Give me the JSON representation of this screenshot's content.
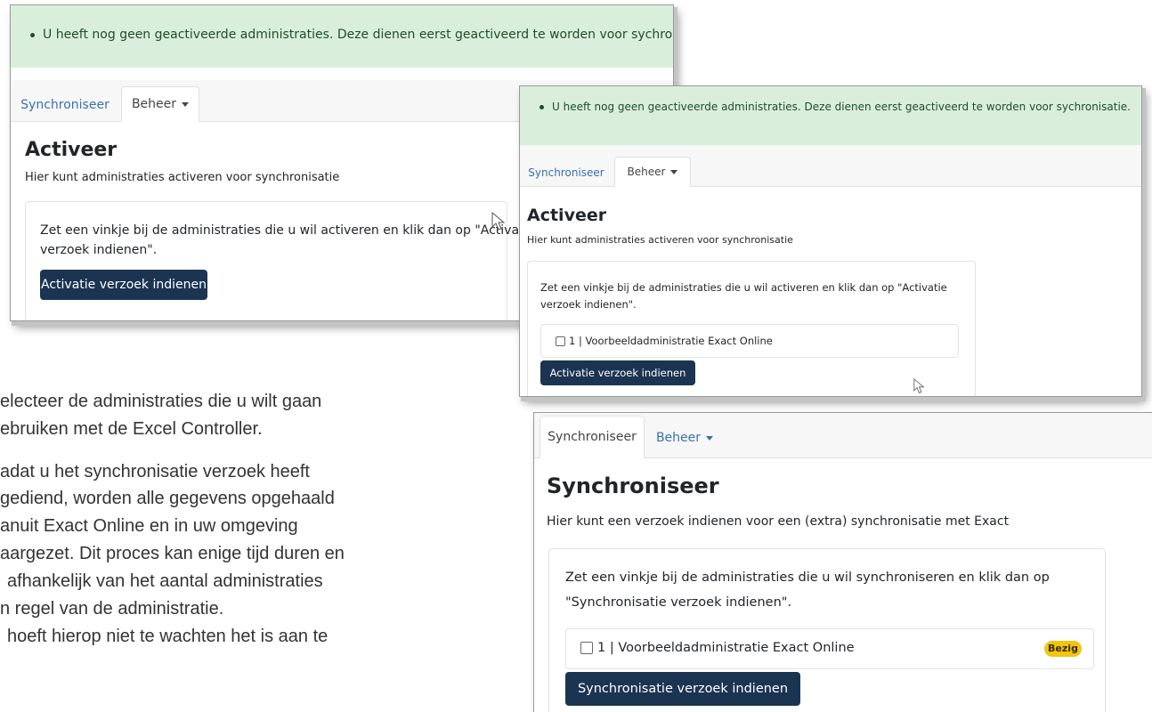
{
  "alert_text": "U heeft nog geen geactiveerde administraties. Deze dienen eerst geactiveerd te worden voor sychronisatie.",
  "tabs": {
    "sync": "Synchroniseer",
    "manage": "Beheer"
  },
  "activate": {
    "title": "Activeer",
    "subtitle": "Hier kunt administraties activeren voor synchronisatie",
    "instruction_line1": "Zet een vinkje bij de administraties die u wil activeren en klik dan op \"Activatie",
    "instruction_line2": "verzoek indienen\".",
    "button": "Activatie verzoek indienen",
    "admin_item": "1 | Voorbeeldadministratie Exact Online"
  },
  "sync": {
    "title": "Synchroniseer",
    "subtitle": "Hier kunt een verzoek indienen voor een (extra) synchronisatie met Exact",
    "instruction_line1": "Zet een vinkje bij de administraties die u wil synchroniseren en klik dan op",
    "instruction_line2": "\"Synchronisatie verzoek indienen\".",
    "admin_item": "1 | Voorbeeldadministratie Exact Online",
    "badge": "Bezig",
    "button": "Synchronisatie verzoek indienen"
  },
  "document_lines": [
    "electeer de administraties die u wilt gaan",
    "ebruiken met de Excel Controller.",
    "adat u het synchronisatie verzoek heeft",
    "gediend, worden alle gegevens opgehaald",
    "anuit Exact Online en in uw omgeving",
    "aargezet. Dit proces kan enige tijd duren en",
    "afhankelijk van het aantal administraties",
    "n regel van de administratie.",
    "hoeft hierop niet te wachten het is aan te"
  ],
  "colors": {
    "alert_bg": "#d9efdc",
    "button_bg": "#1b3452",
    "link": "#3a70b3",
    "badge_bg": "#f2c511"
  }
}
